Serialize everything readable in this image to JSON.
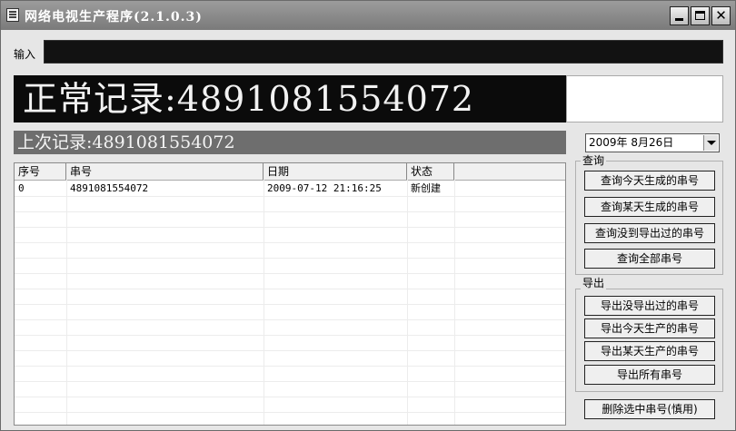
{
  "window": {
    "title": "网络电视生产程序(2.1.0.3)",
    "controls": [
      "minimize",
      "maximize",
      "close"
    ],
    "close_glyph": "✕"
  },
  "input": {
    "label": "输入",
    "value": ""
  },
  "display": {
    "normal_record": "正常记录:4891081554072",
    "last_record": "上次记录:4891081554072"
  },
  "table": {
    "columns": [
      "序号",
      "串号",
      "日期",
      "状态"
    ],
    "rows": [
      {
        "index": "0",
        "serial": "4891081554072",
        "date": "2009-07-12 21:16:25",
        "status": "新创建"
      }
    ]
  },
  "date_picker": {
    "value": "2009年 8月26日"
  },
  "query_group": {
    "label": "查询",
    "buttons": [
      "查询今天生成的串号",
      "查询某天生成的串号",
      "查询没到导出过的串号",
      "查询全部串号"
    ]
  },
  "export_group": {
    "label": "导出",
    "buttons": [
      "导出没导出过的串号",
      "导出今天生产的串号",
      "导出某天生产的串号",
      "导出所有串号"
    ]
  },
  "delete_button": "删除选中串号(慎用)"
}
